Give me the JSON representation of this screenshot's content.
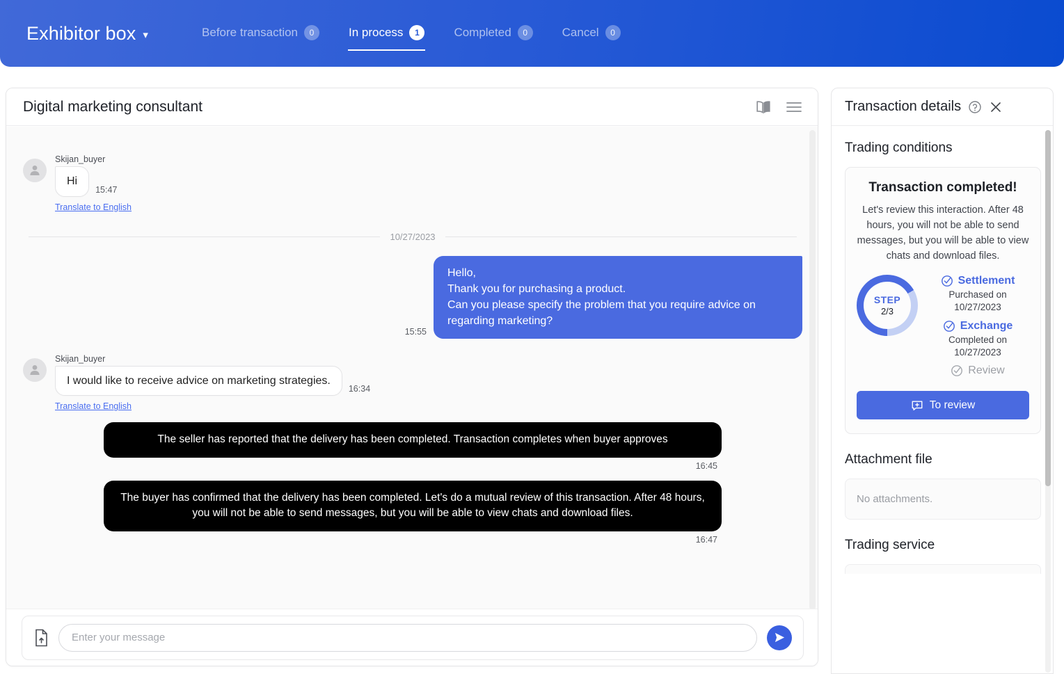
{
  "topbar": {
    "brand": "Exhibitor box",
    "chevron_icon": "chevron-down-icon",
    "tabs": [
      {
        "label": "Before transaction",
        "count": "0",
        "active": false
      },
      {
        "label": "In process",
        "count": "1",
        "active": true
      },
      {
        "label": "Completed",
        "count": "0",
        "active": false
      },
      {
        "label": "Cancel",
        "count": "0",
        "active": false
      }
    ]
  },
  "chat": {
    "title": "Digital marketing consultant",
    "icons": [
      "book-icon",
      "menu-icon"
    ],
    "messages": [
      {
        "kind": "incoming",
        "sender": "Skijan_buyer",
        "text": "Hi",
        "time": "15:47",
        "translate": "Translate to English"
      },
      {
        "kind": "date",
        "date": "10/27/2023"
      },
      {
        "kind": "outgoing",
        "text": "Hello,\nThank you for purchasing a product.\nCan you please specify the problem that you require advice on regarding marketing?",
        "time": "15:55"
      },
      {
        "kind": "incoming",
        "sender": "Skijan_buyer",
        "text": "I would like to receive advice on marketing strategies.",
        "time": "16:34",
        "translate": "Translate to English"
      },
      {
        "kind": "system",
        "text": "The seller has reported that the delivery has been completed. Transaction completes when buyer approves",
        "time": "16:45"
      },
      {
        "kind": "system",
        "text": "The buyer has confirmed that the delivery has been completed. Let's do a mutual review of this transaction. After 48 hours, you will not be able to send messages, but you will be able to view chats and download files.",
        "time": "16:47"
      }
    ],
    "composer": {
      "attach_icon": "file-upload-icon",
      "placeholder": "Enter your message",
      "value": "",
      "send_icon": "send-icon"
    }
  },
  "details": {
    "title": "Transaction details",
    "help_icon": "help-circle-icon",
    "close_icon": "close-icon",
    "trading_conditions": {
      "heading": "Trading conditions",
      "card_title": "Transaction completed!",
      "card_desc": "Let's review this interaction. After 48 hours, you will not be able to send messages, but you will be able to view chats and download files.",
      "step_ring": {
        "label": "STEP",
        "fraction": "2/3",
        "percent": 67
      },
      "steps": [
        {
          "name": "Settlement",
          "detail": "Purchased on 10/27/2023",
          "done": true
        },
        {
          "name": "Exchange",
          "detail": "Completed on 10/27/2023",
          "done": true
        },
        {
          "name": "Review",
          "detail": "",
          "done": false
        }
      ],
      "button": {
        "label": "To review",
        "icon": "review-bubble-icon"
      }
    },
    "attachment": {
      "heading": "Attachment file",
      "empty": "No attachments."
    },
    "trading_service": {
      "heading": "Trading service"
    }
  },
  "colors": {
    "brand_blue": "#4a6ae0",
    "header_gradient_from": "#4169d8",
    "header_gradient_to": "#0a4bd0",
    "system_bubble": "#000000",
    "link": "#4a6ef0"
  }
}
